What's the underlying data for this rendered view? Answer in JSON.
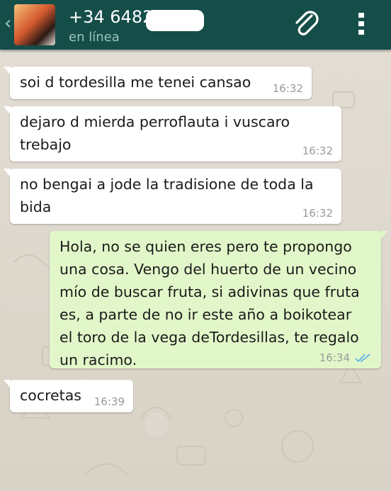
{
  "header": {
    "contact_name": "+34 64828",
    "status": "en línea",
    "back_glyph": "‹",
    "icons": [
      "back-icon",
      "avatar",
      "paperclip-icon",
      "overflow-menu-icon"
    ]
  },
  "messages": [
    {
      "direction": "in",
      "text": "soi d tordesilla me tenei cansao",
      "time": "16:32"
    },
    {
      "direction": "in",
      "text": "dejaro d mierda perroflauta i vuscaro\ntrebajo",
      "time": "16:32"
    },
    {
      "direction": "in",
      "text": "no bengai a jode la tradisione de toda la\nbida",
      "time": "16:32"
    },
    {
      "direction": "out",
      "text": "Hola, no se quien eres pero te propongo\nuna cosa. Vengo del huerto de un vecino\nmío de buscar fruta, si adivinas que fruta\nes, a parte de no ir este año a boikotear\nel toro de la vega deTordesillas, te regalo\nun racimo.",
      "time": "16:34",
      "status_icon": "double-check-icon"
    },
    {
      "direction": "in",
      "text": "cocretas",
      "time": "16:39"
    }
  ],
  "colors": {
    "header": "#154e49",
    "incoming_bubble": "#ffffff",
    "outgoing_bubble": "#e2f7c9",
    "wallpaper": "#dcd6cb",
    "read_ticks": "#5fb6e6"
  }
}
